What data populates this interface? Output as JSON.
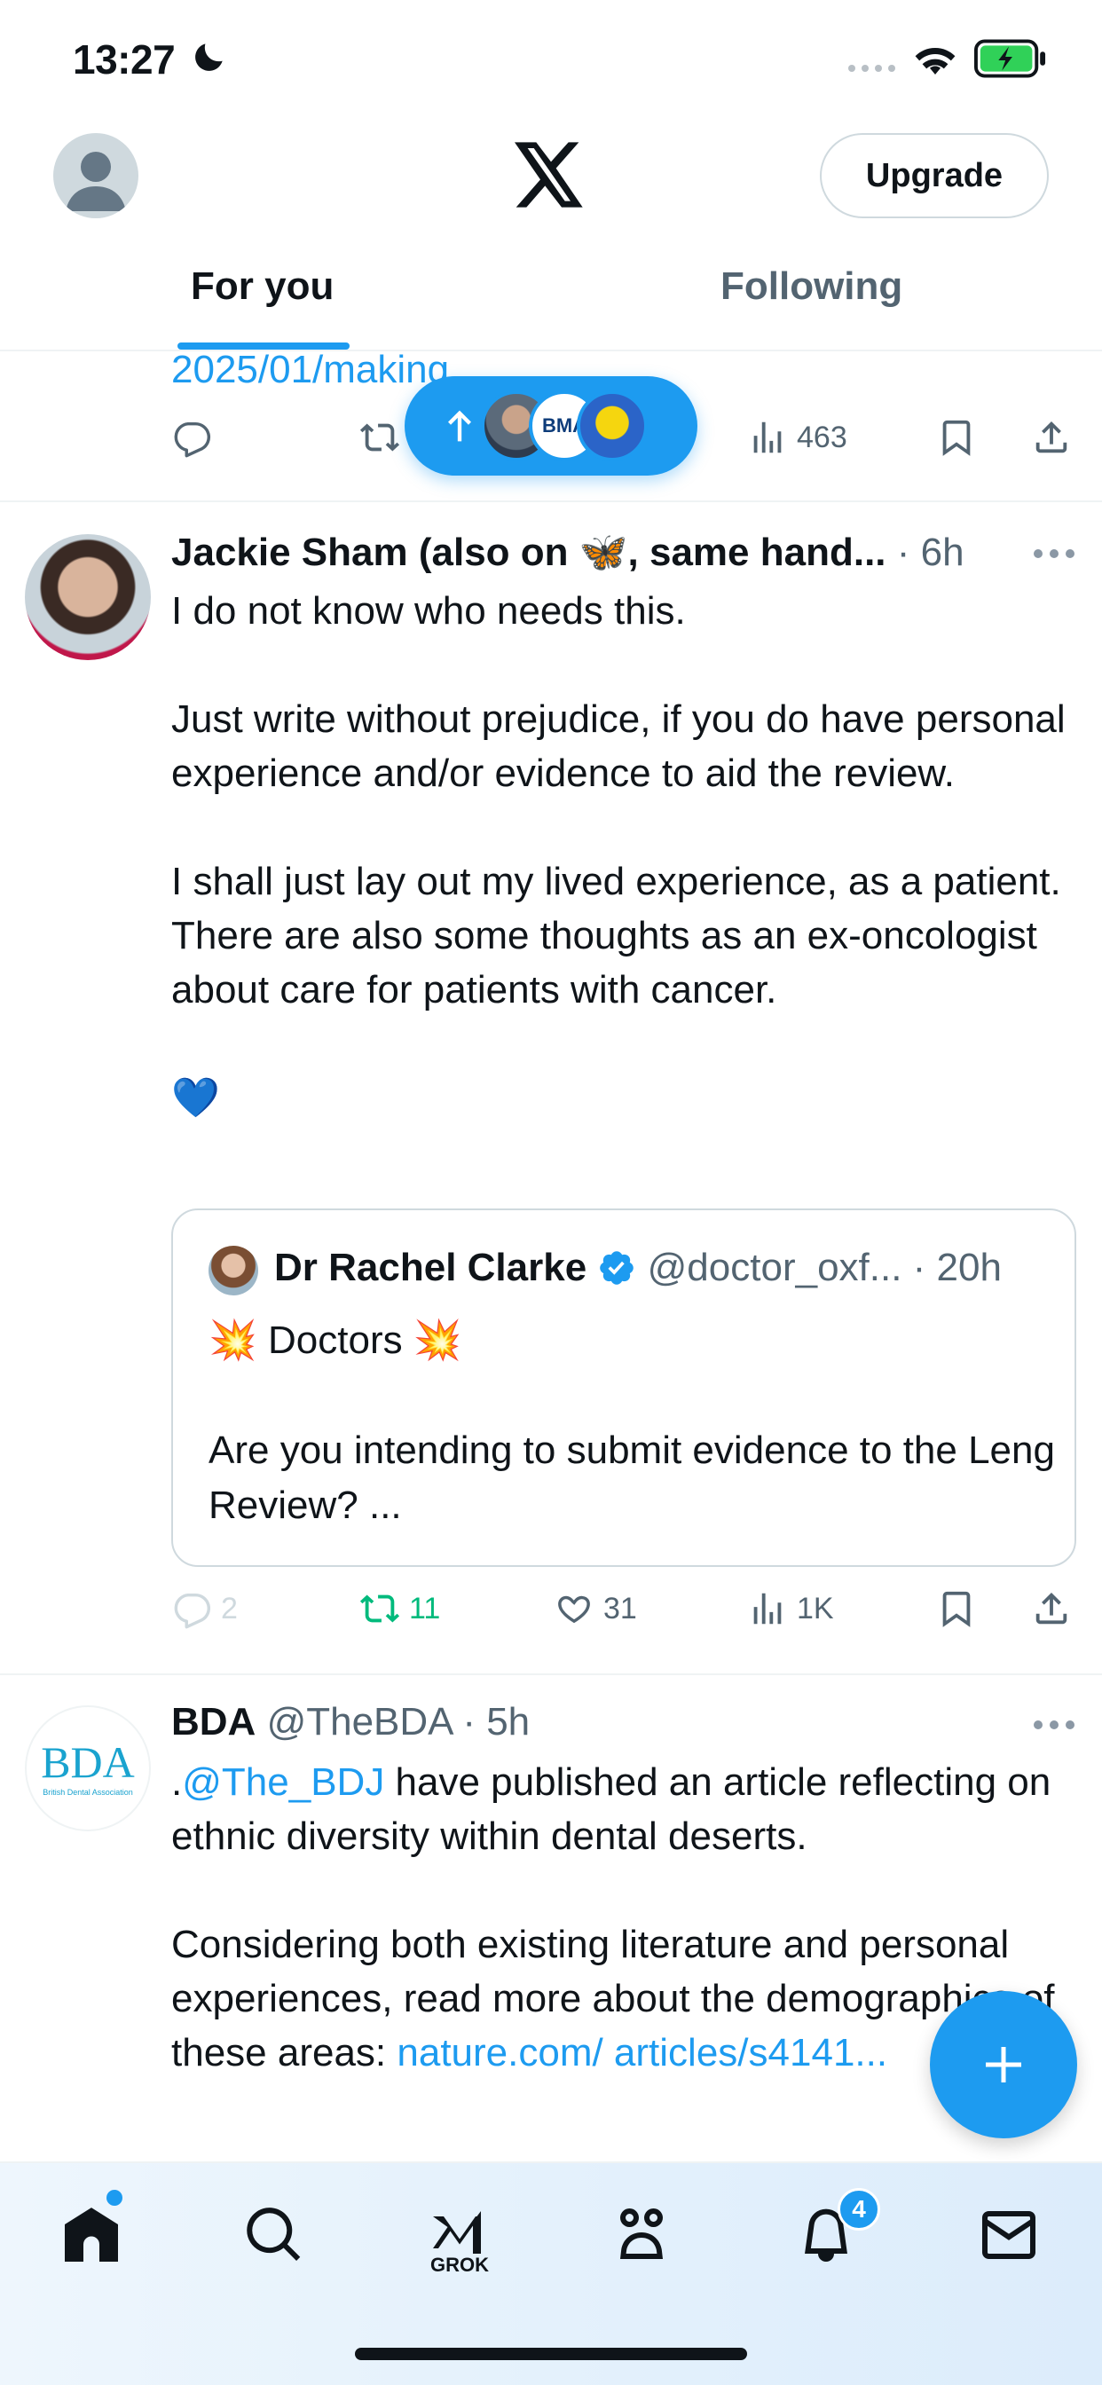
{
  "status_bar": {
    "time": "13:27"
  },
  "header": {
    "upgrade_label": "Upgrade",
    "tabs": [
      {
        "label": "For you",
        "active": true
      },
      {
        "label": "Following",
        "active": false
      }
    ]
  },
  "new_posts_pill": {
    "avatar_text": "BMA"
  },
  "partial_tweet": {
    "link_text": "2025/01/making",
    "views": "463"
  },
  "tweets": [
    {
      "name": "Jackie Sham (also on 🦋, same hand...",
      "time": "6h",
      "body": "I do not know who needs this.\n\nJust write without prejudice, if you do have personal experience and/or evidence to aid the review.\n\nI shall just lay out my lived experience, as a patient. There are also some thoughts as an ex-oncologist about care for patients with cancer.\n\n💙",
      "quote": {
        "name": "Dr Rachel Clarke",
        "handle": "@doctor_oxf...",
        "time": "20h",
        "body": "💥 Doctors 💥\n\nAre you intending to submit evidence to the Leng Review? ..."
      },
      "replies": "2",
      "reposts": "11",
      "likes": "31",
      "views": "1K"
    },
    {
      "name": "BDA",
      "handle": "@TheBDA",
      "time": "5h",
      "avatar_text": "BDA",
      "avatar_subtext": "British Dental Association",
      "body_prefix": ".",
      "body_mention": "@The_BDJ",
      "body_main": " have published an article reflecting on ethnic diversity within dental deserts.\n\nConsidering both existing literature and personal experiences, read more about the demographics of these areas: ",
      "body_link": "nature.com/ articles/s4141..."
    }
  ],
  "bottom_nav": {
    "grok_label": "GROK",
    "notifications_count": "4"
  },
  "colors": {
    "accent": "#1d9bf0",
    "repost_active": "#00ba7c",
    "muted": "#536471"
  }
}
